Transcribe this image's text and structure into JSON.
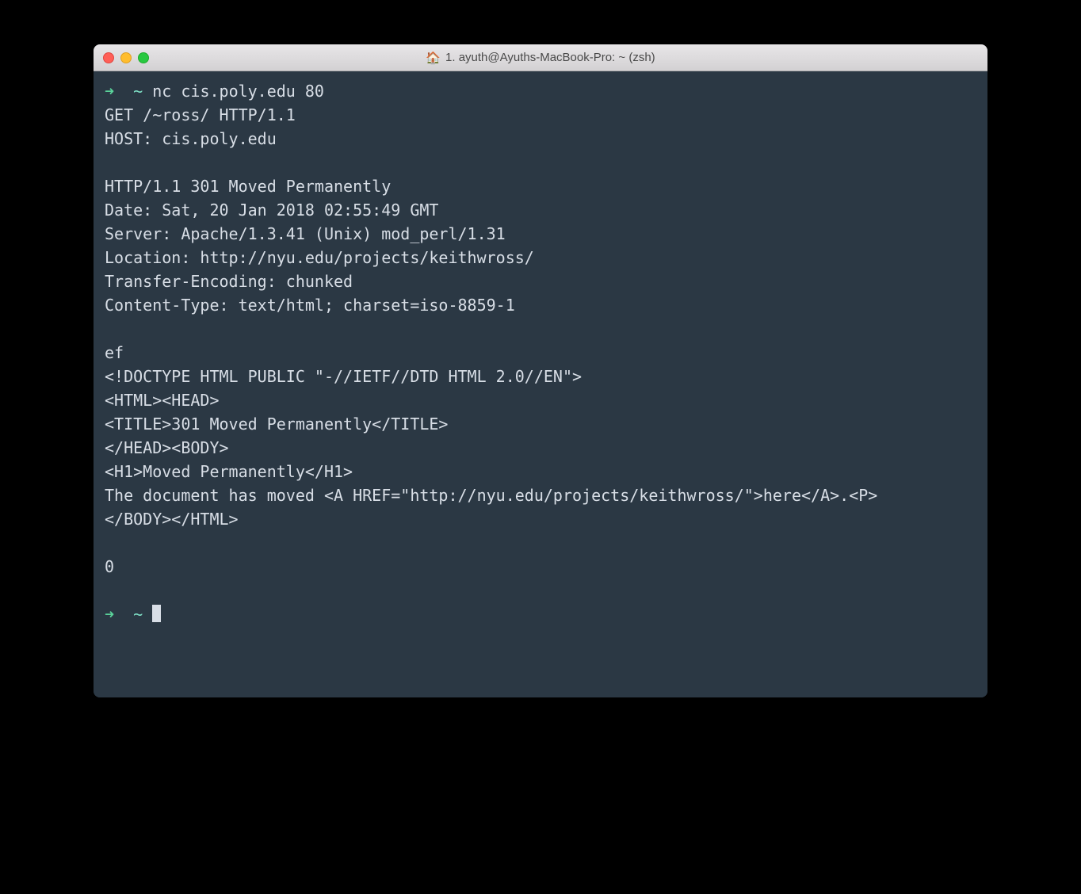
{
  "window": {
    "title": "1. ayuth@Ayuths-MacBook-Pro: ~ (zsh)",
    "home_icon": "🏠"
  },
  "terminal": {
    "prompt_arrow": "➜",
    "prompt_path": "~",
    "command1": "nc cis.poly.edu 80",
    "lines": [
      "GET /~ross/ HTTP/1.1",
      "HOST: cis.poly.edu",
      "",
      "HTTP/1.1 301 Moved Permanently",
      "Date: Sat, 20 Jan 2018 02:55:49 GMT",
      "Server: Apache/1.3.41 (Unix) mod_perl/1.31",
      "Location: http://nyu.edu/projects/keithwross/",
      "Transfer-Encoding: chunked",
      "Content-Type: text/html; charset=iso-8859-1",
      "",
      "ef",
      "<!DOCTYPE HTML PUBLIC \"-//IETF//DTD HTML 2.0//EN\">",
      "<HTML><HEAD>",
      "<TITLE>301 Moved Permanently</TITLE>",
      "</HEAD><BODY>",
      "<H1>Moved Permanently</H1>",
      "The document has moved <A HREF=\"http://nyu.edu/projects/keithwross/\">here</A>.<P>",
      "</BODY></HTML>",
      "",
      "0",
      ""
    ]
  }
}
